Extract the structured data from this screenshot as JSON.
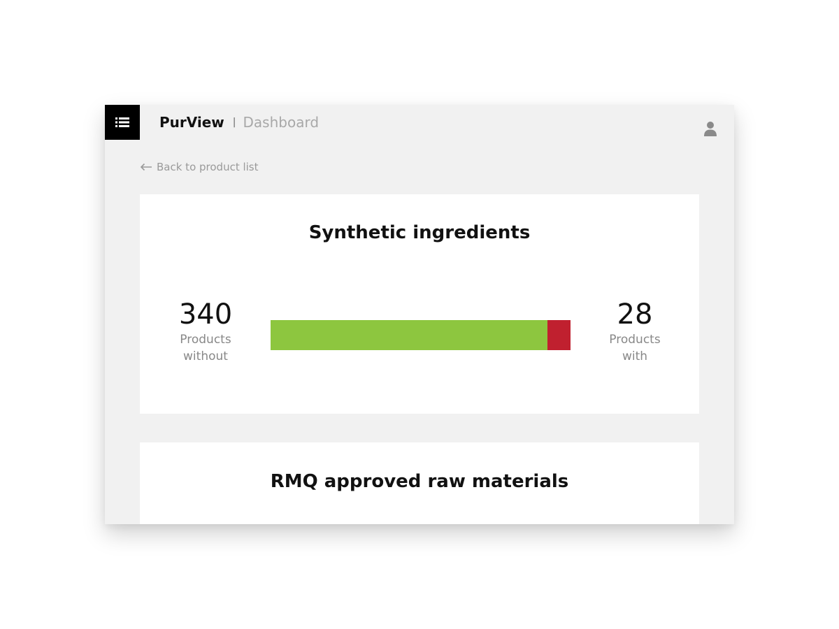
{
  "colors": {
    "window_bg": "#f1f1f1",
    "menu_bg": "#000000",
    "accent_green": "#8dc63f",
    "accent_red": "#c0202f"
  },
  "header": {
    "menu_icon": "list-icon",
    "brand": "PurView",
    "separator": "|",
    "page": "Dashboard",
    "user_icon": "user-icon"
  },
  "nav": {
    "back_icon": "arrow-left-icon",
    "back_label": "Back to product list"
  },
  "cards": [
    {
      "title": "Synthetic ingredients",
      "without": {
        "value": "340",
        "label_line1": "Products",
        "label_line2": "without"
      },
      "with": {
        "value": "28",
        "label_line1": "Products",
        "label_line2": "with"
      },
      "bar": {
        "without_count": 340,
        "with_count": 28
      }
    },
    {
      "title": "RMQ approved raw materials"
    }
  ]
}
